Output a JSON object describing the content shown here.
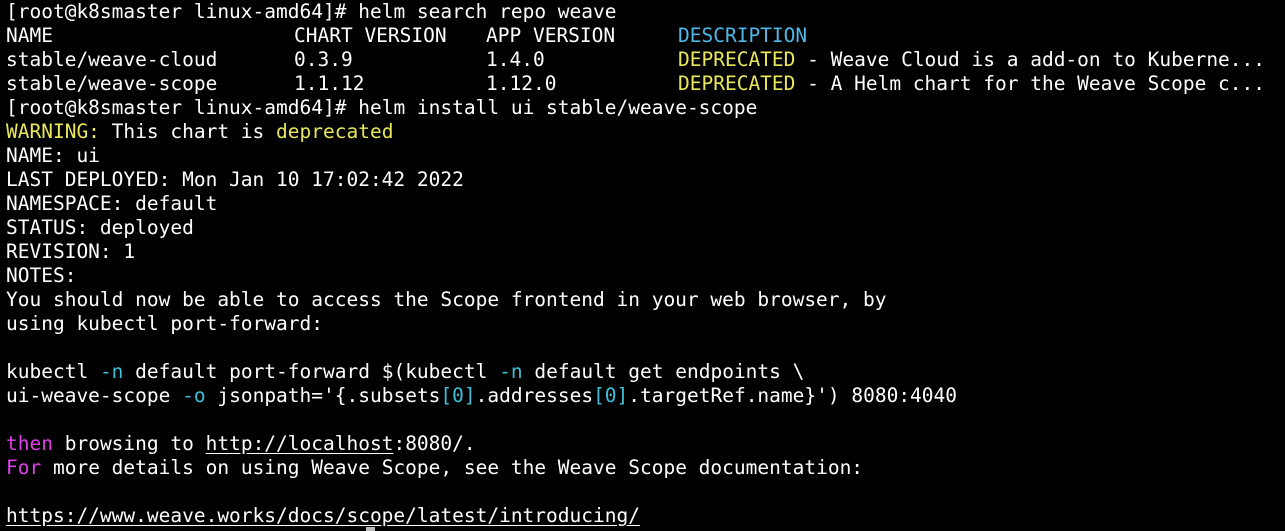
{
  "terminal": {
    "cmd1": {
      "prompt": "[root@k8smaster linux-amd64]#",
      "command": "helm search repo weave"
    },
    "table": {
      "headers": [
        "NAME",
        "CHART VERSION",
        "APP VERSION",
        "DESCRIPTION"
      ],
      "rows": [
        [
          "stable/weave-cloud",
          "0.3.9",
          "1.4.0",
          "DEPRECATED",
          "- Weave Cloud is a add-on to Kuberne..."
        ],
        [
          "stable/weave-scope",
          "1.1.12",
          "1.12.0",
          "DEPRECATED",
          "- A Helm chart for the Weave Scope c..."
        ]
      ]
    },
    "cmd2": {
      "prompt": "[root@k8smaster linux-amd64]#",
      "command": "helm install ui stable/weave-scope"
    },
    "warning": {
      "label": "WARNING:",
      "text": "This chart is",
      "highlight": "deprecated"
    },
    "name_line": "NAME: ui",
    "last_deployed": "LAST DEPLOYED: Mon Jan 10 17:02:42 2022",
    "namespace": "NAMESPACE: default",
    "status": "STATUS: deployed",
    "revision": "REVISION: 1",
    "notes": "NOTES:",
    "notes_line1": "You should now be able to access the Scope frontend in your web browser, by",
    "notes_line2": "using kubectl port-forward:",
    "kubectl1": {
      "a": "kubectl",
      "flag1": "-n",
      "b": "default port-forward $(kubectl",
      "flag2": "-n",
      "c": "default get endpoints \\"
    },
    "kubectl2": {
      "a": "ui-weave-scope",
      "flag": "-o",
      "b": "jsonpath='{.subsets",
      "idx1": "[0]",
      "c": ".addresses",
      "idx2": "[0]",
      "d": ".targetRef.name}') 8080:4040"
    },
    "then_line": {
      "keyword": "then",
      "text": "browsing to",
      "url": "http://localhost",
      "port": ":8080/."
    },
    "for_line": {
      "keyword": "For",
      "text": "more details on using Weave Scope, see the Weave Scope documentation:"
    },
    "docs_url": "https://www.weave.works/docs/scope/latest/introducing/"
  }
}
